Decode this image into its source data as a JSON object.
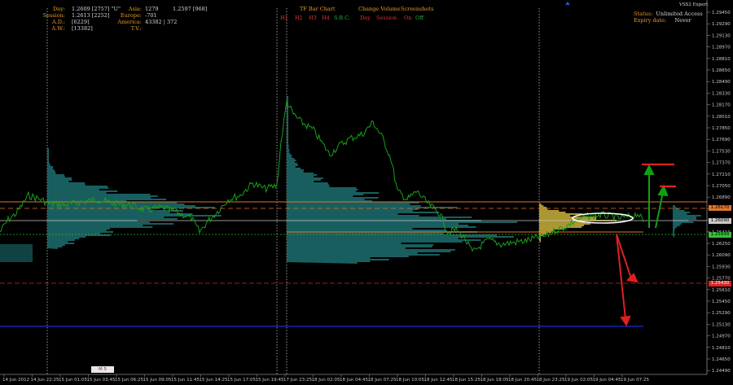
{
  "stats_panel": {
    "rows": [
      {
        "label": "Day:",
        "value": "1.2609 [2757]  \"U\""
      },
      {
        "label": "Session:",
        "value": "1.2613 [2252]"
      },
      {
        "label": "A.D.:",
        "value": "[6229]"
      },
      {
        "label": "A.W.:",
        "value": "[13382]"
      }
    ]
  },
  "session_panel": {
    "rows": [
      {
        "label": "Asia:",
        "value": "1279",
        "extra": "1.2597 [968]"
      },
      {
        "label": "Europe:",
        "value": "-701",
        "extra": ""
      },
      {
        "label": "America:",
        "value": "",
        "extra": ""
      },
      {
        "label": "T.V.:",
        "value": "43382 | 372",
        "extra": ""
      }
    ]
  },
  "toolbar": {
    "tf_bar_chart": "TF Bar Chart",
    "change_volume": "Change Volume",
    "screenshots": "Screenshots",
    "tf_buttons": [
      {
        "label": "H1",
        "color": "#e03030"
      },
      {
        "label": "H2",
        "color": "#e03030"
      },
      {
        "label": "H3",
        "color": "#e03030"
      },
      {
        "label": "H4",
        "color": "#e03030"
      },
      {
        "label": "S.B.C.",
        "color": "#20b040"
      }
    ],
    "volume_buttons": [
      {
        "label": "Day",
        "color": "#e03030"
      },
      {
        "label": "Session",
        "color": "#e03030"
      }
    ],
    "screenshot_buttons": [
      {
        "label": "On",
        "color": "#e03030"
      },
      {
        "label": "Off",
        "color": "#20b040"
      }
    ]
  },
  "expert_status": {
    "title": "VSS2 Expert",
    "status_label": "Status:",
    "status_value": "Unlimited Access",
    "expiry_label": "Expiry date:",
    "expiry_value": "Never"
  },
  "price_axis": {
    "ticks": [
      "1.29450",
      "1.29290",
      "1.29130",
      "1.28970",
      "1.28810",
      "1.28650",
      "1.28490",
      "1.28330",
      "1.28170",
      "1.28010",
      "1.27850",
      "1.27690",
      "1.27530",
      "1.27370",
      "1.27210",
      "1.27050",
      "1.26890",
      "1.26730",
      "1.26570",
      "1.26410",
      "1.26250",
      "1.26090",
      "1.25930",
      "1.25770",
      "1.25610",
      "1.25450",
      "1.25290",
      "1.25130",
      "1.24970",
      "1.24810",
      "1.24650",
      "1.24490"
    ],
    "labels": [
      {
        "text": "1.26170",
        "color": "#e0762b"
      },
      {
        "text": "1.26090",
        "color": "#c9c9c9"
      },
      {
        "text": "1.25930",
        "color": "#38c138"
      },
      {
        "text": "1.25430",
        "color": "#e02020"
      }
    ]
  },
  "time_axis": {
    "labels": [
      "14 Jun 2012",
      "14 Jun 22:25",
      "15 Jun 01:05",
      "15 Jun 03:45",
      "15 Jun 06:25",
      "15 Jun 09:05",
      "15 Jun 11:45",
      "15 Jun 14:25",
      "15 Jun 17:05",
      "15 Jun 19:45",
      "17 Jun 23:25",
      "18 Jun 02:05",
      "18 Jun 04:45",
      "18 Jun 07:25",
      "18 Jun 10:05",
      "18 Jun 12:45",
      "18 Jun 15:25",
      "18 Jun 18:05",
      "18 Jun 20:45",
      "18 Jun 23:25",
      "19 Jun 02:05",
      "19 Jun 04:45",
      "19 Jun 07:25"
    ]
  },
  "chart_tag": "M 5",
  "colors": {
    "price_line": "#18a018",
    "profile": "#1d6e70",
    "profile_highlight": "#c9b23c",
    "value_area": "#e0762b",
    "down_arrow": "#e02020",
    "up_arrow": "#12a012",
    "support": "#1c2ad0"
  }
}
